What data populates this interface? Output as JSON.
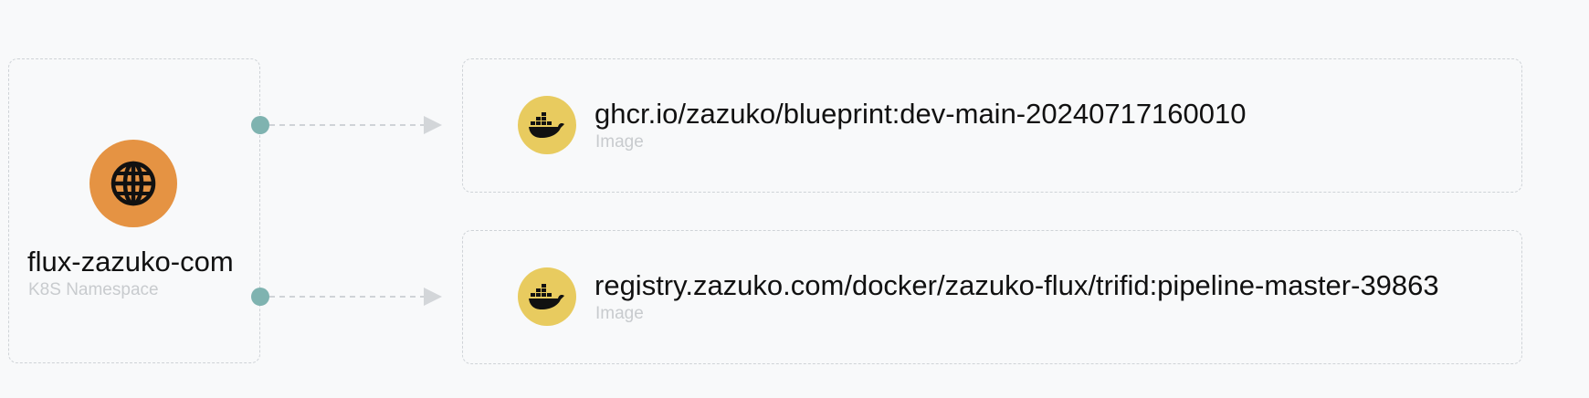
{
  "colors": {
    "namespace_icon_bg": "#e59343",
    "image_icon_bg": "#e8cb5f",
    "port": "#7fb3b0",
    "edge": "#cfd3d7",
    "node_border": "#cfd3d7",
    "background": "#f8f9fa"
  },
  "namespace_node": {
    "icon": "globe-icon",
    "title": "flux-zazuko-com",
    "subtitle": "K8S Namespace"
  },
  "image_nodes": [
    {
      "icon": "docker-icon",
      "title": "ghcr.io/zazuko/blueprint:dev-main-20240717160010",
      "subtitle": "Image"
    },
    {
      "icon": "docker-icon",
      "title": "registry.zazuko.com/docker/zazuko-flux/trifid:pipeline-master-39863",
      "subtitle": "Image"
    }
  ]
}
